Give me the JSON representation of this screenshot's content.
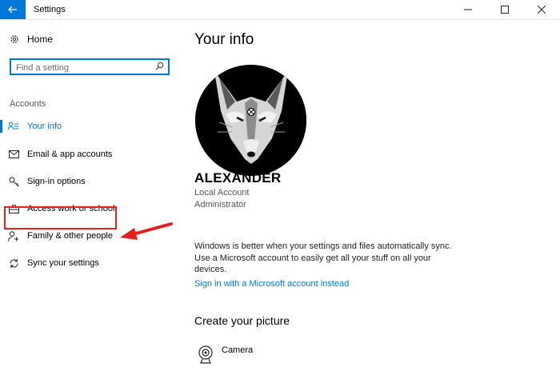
{
  "window": {
    "title": "Settings",
    "back_icon": "back-arrow-icon",
    "accent": "#0078d7"
  },
  "sidebar": {
    "home_label": "Home",
    "search_placeholder": "Find a setting",
    "section_label": "Accounts",
    "items": [
      {
        "label": "Your info",
        "icon": "person-list-icon",
        "active": true
      },
      {
        "label": "Email & app accounts",
        "icon": "envelope-icon",
        "active": false
      },
      {
        "label": "Sign-in options",
        "icon": "key-icon",
        "active": false
      },
      {
        "label": "Access work or school",
        "icon": "briefcase-icon",
        "active": false
      },
      {
        "label": "Family & other people",
        "icon": "person-add-icon",
        "active": false
      },
      {
        "label": "Sync your settings",
        "icon": "sync-icon",
        "active": false
      }
    ]
  },
  "main": {
    "title": "Your info",
    "user_name": "ALEXANDER",
    "account_type": "Local Account",
    "account_role": "Administrator",
    "sync_text": "Windows is better when your settings and files automatically sync. Use a Microsoft account to easily get all your stuff on all your devices.",
    "link_text": "Sign in with a Microsoft account instead",
    "picture_heading": "Create your picture",
    "camera_label": "Camera"
  },
  "annotation": {
    "highlight_color": "#e5201e"
  }
}
